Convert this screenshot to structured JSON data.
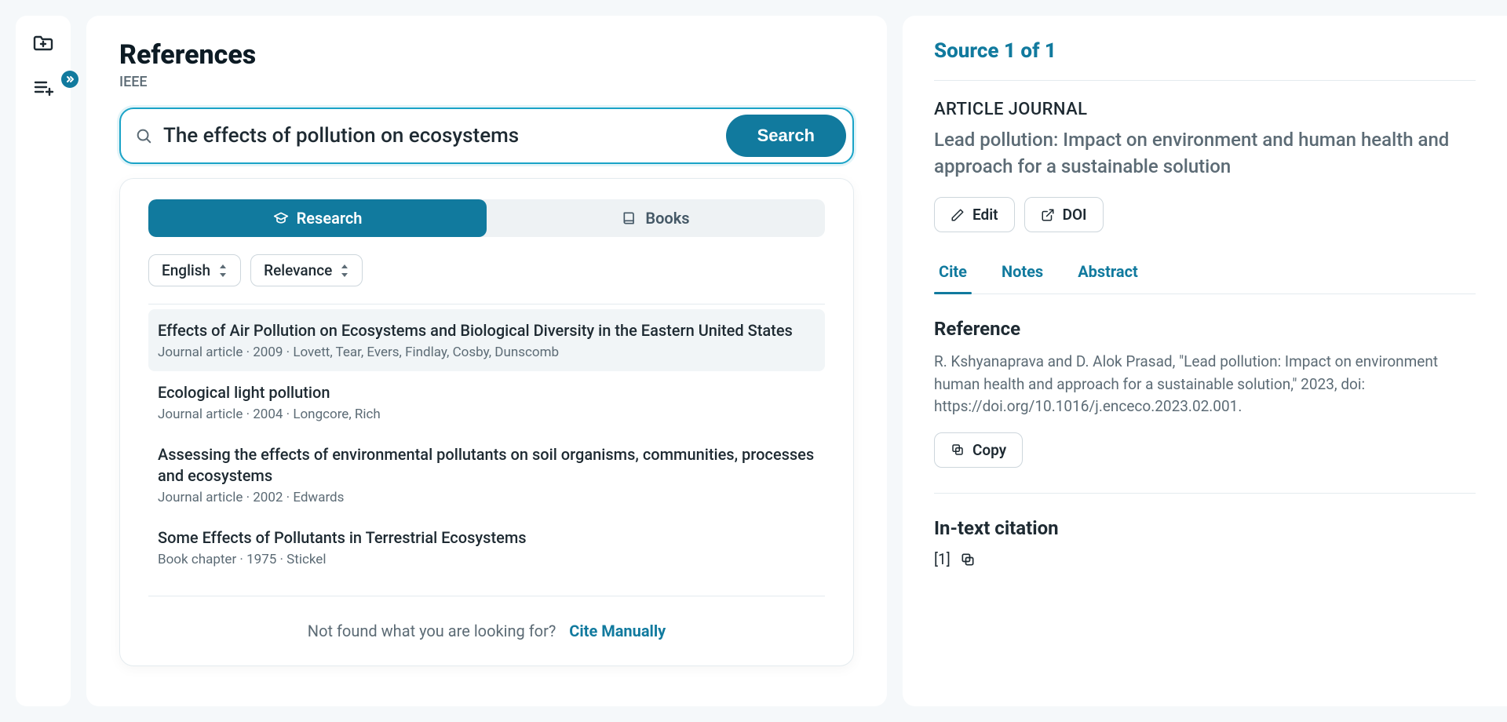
{
  "sidebar": {
    "expand_tooltip": "Expand"
  },
  "main": {
    "title": "References",
    "style": "IEEE",
    "search": {
      "value": "The effects of pollution on ecosystems",
      "placeholder": "Search references",
      "button": "Search"
    },
    "tabs": [
      {
        "label": "Research",
        "active": true
      },
      {
        "label": "Books",
        "active": false
      }
    ],
    "filters": {
      "language": "English",
      "sort": "Relevance"
    },
    "results": [
      {
        "title": "Effects of Air Pollution on Ecosystems and Biological Diversity in the Eastern United States",
        "meta": "Journal article · 2009 · Lovett, Tear, Evers, Findlay, Cosby, Dunscomb"
      },
      {
        "title": "Ecological light pollution",
        "meta": "Journal article · 2004 · Longcore, Rich"
      },
      {
        "title": "Assessing the effects of environmental pollutants on soil organisms, communities, processes and ecosystems",
        "meta": "Journal article · 2002 · Edwards"
      },
      {
        "title": "Some Effects of Pollutants in Terrestrial Ecosystems",
        "meta": "Book chapter · 1975 · Stickel"
      }
    ],
    "not_found": {
      "prompt": "Not found what you are looking for?",
      "action": "Cite Manually"
    }
  },
  "detail": {
    "pager": "Source 1 of 1",
    "type": "ARTICLE JOURNAL",
    "title": "Lead pollution: Impact on environment and human health and approach for a sustainable solution",
    "buttons": {
      "edit": "Edit",
      "doi": "DOI"
    },
    "tabs": [
      {
        "label": "Cite",
        "active": true
      },
      {
        "label": "Notes",
        "active": false
      },
      {
        "label": "Abstract",
        "active": false
      }
    ],
    "reference": {
      "heading": "Reference",
      "text": "R. Kshyanaprava and D. Alok Prasad, \"Lead pollution: Impact on environment human health and approach for a sustainable solution,\" 2023, doi: https://doi.org/10.1016/j.enceco.2023.02.001.",
      "copy": "Copy"
    },
    "intext": {
      "heading": "In-text citation",
      "value": "[1]"
    }
  }
}
